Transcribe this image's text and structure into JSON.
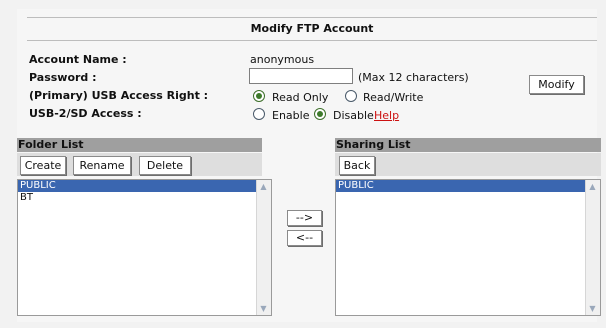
{
  "title": "Modify FTP Account",
  "account": {
    "name_label": "Account Name :",
    "name_value": "anonymous",
    "password_label": "Password :",
    "password_value": "",
    "password_hint": "(Max 12 characters)",
    "usb_label": "(Primary) USB Access Right :",
    "usb_options": [
      "Read Only",
      "Read/Write"
    ],
    "usb_selected": "Read Only",
    "sd_label": "USB-2/SD Access :",
    "sd_options": [
      "Enable",
      "Disable"
    ],
    "sd_selected": "Disable",
    "help_label": "Help",
    "modify_label": "Modify"
  },
  "folder_list": {
    "header": "Folder List",
    "buttons": [
      "Create",
      "Rename",
      "Delete"
    ],
    "items": [
      "PUBLIC",
      "BT"
    ],
    "selected": "PUBLIC"
  },
  "transfer": {
    "add_label": "-->",
    "remove_label": "<--"
  },
  "sharing_list": {
    "header": "Sharing List",
    "back_label": "Back",
    "items": [
      "PUBLIC"
    ],
    "selected": "PUBLIC"
  },
  "colors": {
    "selection": "#3a66b0",
    "header_gray": "#9f9f9f",
    "help_red": "#cc1111"
  }
}
